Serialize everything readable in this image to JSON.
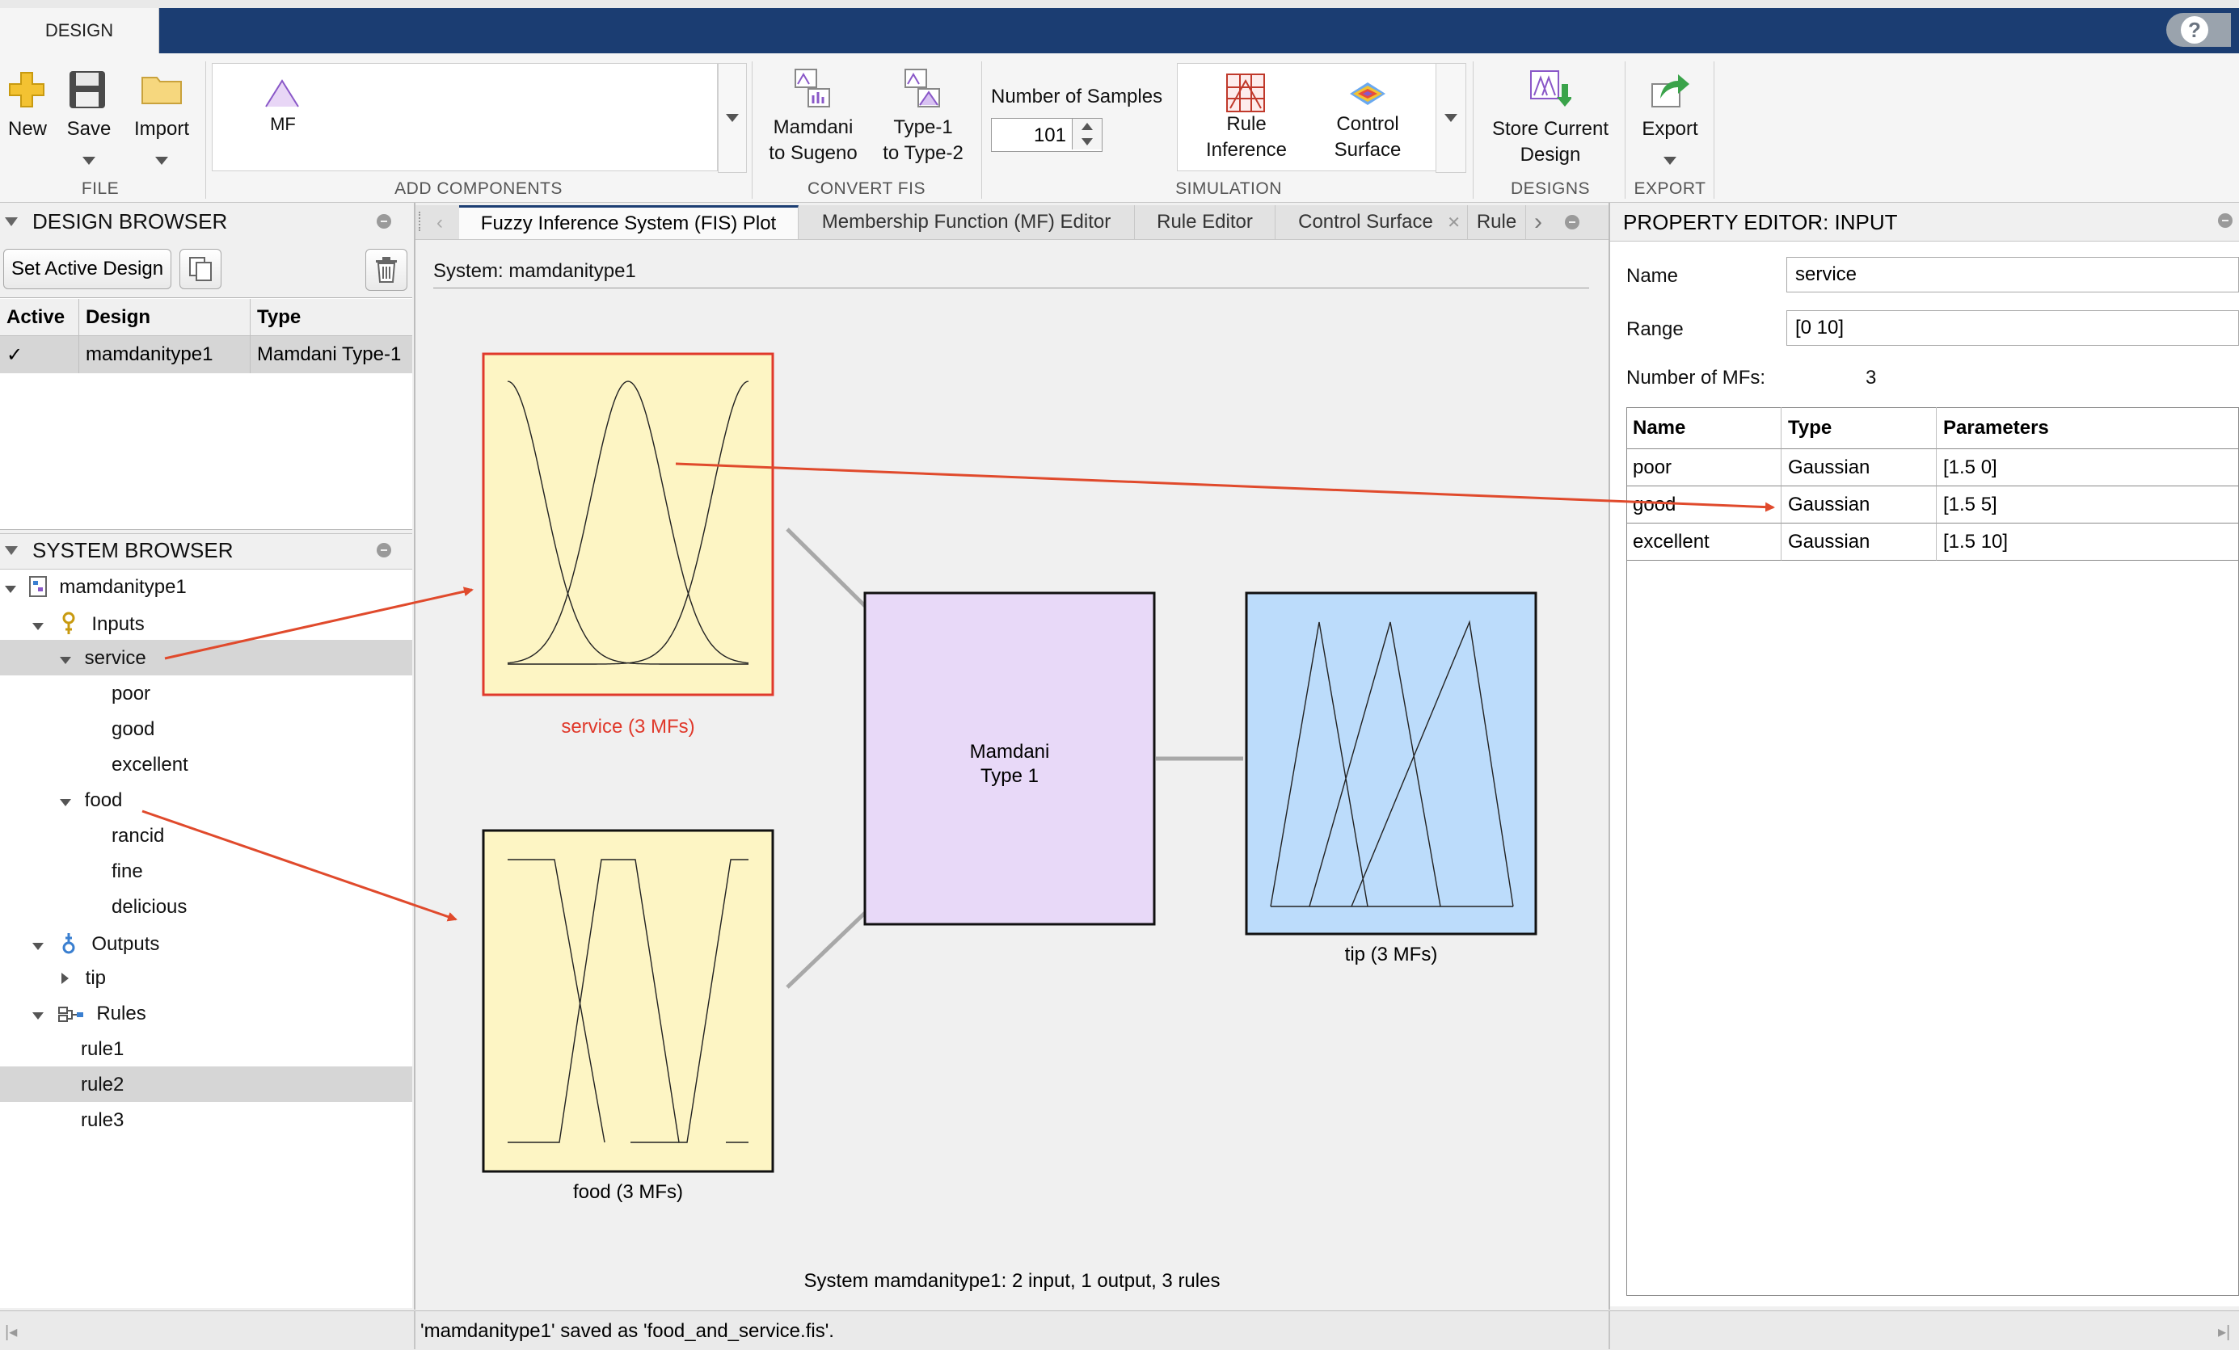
{
  "toolstrip": {
    "tab_label": "DESIGN",
    "file": {
      "new": "New",
      "save": "Save",
      "import": "Import",
      "group": "FILE"
    },
    "add_components": {
      "mf": "MF",
      "group": "ADD COMPONENTS"
    },
    "convert": {
      "mamdani_to_sugeno": [
        "Mamdani",
        "to Sugeno"
      ],
      "type1_to_type2": [
        "Type-1",
        "to Type-2"
      ],
      "group": "CONVERT FIS"
    },
    "samples": {
      "label": "Number of Samples",
      "value": "101"
    },
    "simulation": {
      "rule_inference": [
        "Rule",
        "Inference"
      ],
      "control_surface": [
        "Control",
        "Surface"
      ],
      "group": "SIMULATION"
    },
    "designs": {
      "store_current": [
        "Store Current",
        "Design"
      ],
      "group": "DESIGNS"
    },
    "export": {
      "label": "Export",
      "group": "EXPORT"
    },
    "help": "?"
  },
  "design_browser": {
    "title": "DESIGN BROWSER",
    "set_active": "Set Active Design",
    "columns": [
      "Active",
      "Design",
      "Type"
    ],
    "rows": [
      {
        "active": "✓",
        "design": "mamdanitype1",
        "type": "Mamdani Type-1"
      }
    ]
  },
  "system_browser": {
    "title": "SYSTEM BROWSER",
    "root": "mamdanitype1",
    "inputs_label": "Inputs",
    "service": "service",
    "service_mfs": [
      "poor",
      "good",
      "excellent"
    ],
    "food": "food",
    "food_mfs": [
      "rancid",
      "fine",
      "delicious"
    ],
    "outputs_label": "Outputs",
    "tip": "tip",
    "rules_label": "Rules",
    "rules": [
      "rule1",
      "rule2",
      "rule3"
    ]
  },
  "doc_tabs": [
    "Fuzzy Inference System (FIS) Plot",
    "Membership Function (MF) Editor",
    "Rule Editor",
    "Control Surface",
    "Rule"
  ],
  "fis_plot": {
    "system_label": "System: mamdanitype1",
    "service_caption": "service (3 MFs)",
    "food_caption": "food (3 MFs)",
    "engine": [
      "Mamdani",
      "Type 1"
    ],
    "tip_caption": "tip (3 MFs)",
    "summary": "System mamdanitype1: 2 input, 1 output, 3 rules",
    "colors": {
      "input_fill": "#fdf5c4",
      "engine_fill": "#e8d9f8",
      "output_fill": "#bcdcfb",
      "selected_border": "#e0392b",
      "annotation_arrow": "#e04a2c"
    }
  },
  "property_editor": {
    "title": "PROPERTY EDITOR: INPUT",
    "name_label": "Name",
    "name_value": "service",
    "range_label": "Range",
    "range_value": "[0 10]",
    "num_mfs_label": "Number of MFs:",
    "num_mfs_value": "3",
    "columns": [
      "Name",
      "Type",
      "Parameters"
    ],
    "rows": [
      {
        "name": "poor",
        "type": "Gaussian",
        "params": "[1.5 0]"
      },
      {
        "name": "good",
        "type": "Gaussian",
        "params": "[1.5 5]"
      },
      {
        "name": "excellent",
        "type": "Gaussian",
        "params": "[1.5 10]"
      }
    ]
  },
  "status_bar": "'mamdanitype1' saved as 'food_and_service.fis'."
}
